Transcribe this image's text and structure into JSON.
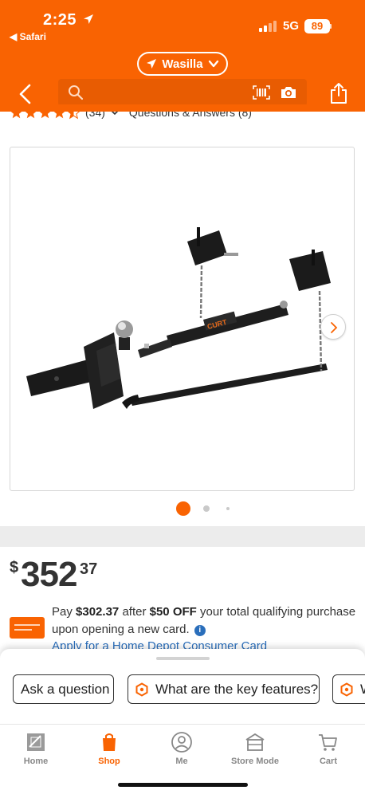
{
  "status_bar": {
    "time": "2:25",
    "back_app": "◀ Safari",
    "network": "5G",
    "battery": "89"
  },
  "header": {
    "store_selector": "Wasilla",
    "search_placeholder": ""
  },
  "rating": {
    "stars": 4.5,
    "count": "(34)",
    "qa_link": "Questions & Answers (8)"
  },
  "gallery": {
    "active_index": 1,
    "dots": 3
  },
  "price": {
    "symbol": "$",
    "dollars": "352",
    "cents": "37"
  },
  "promo": {
    "pay_label": "Pay",
    "pay_amount": "$302.37",
    "after_label": "after",
    "discount": "$50 OFF",
    "rest": "your total qualifying purchase upon opening a new card.",
    "apply_link": "Apply for a Home Depot Consumer Card"
  },
  "chips": [
    {
      "label": "Ask a question"
    },
    {
      "label": "What are the key features?"
    },
    {
      "label": "W"
    }
  ],
  "tabs": [
    {
      "label": "Home"
    },
    {
      "label": "Shop"
    },
    {
      "label": "Me"
    },
    {
      "label": "Store Mode"
    },
    {
      "label": "Cart"
    }
  ],
  "product_brand_text": "CURT",
  "colors": {
    "brand_orange": "#f96302",
    "link_blue": "#2a6ebb"
  }
}
